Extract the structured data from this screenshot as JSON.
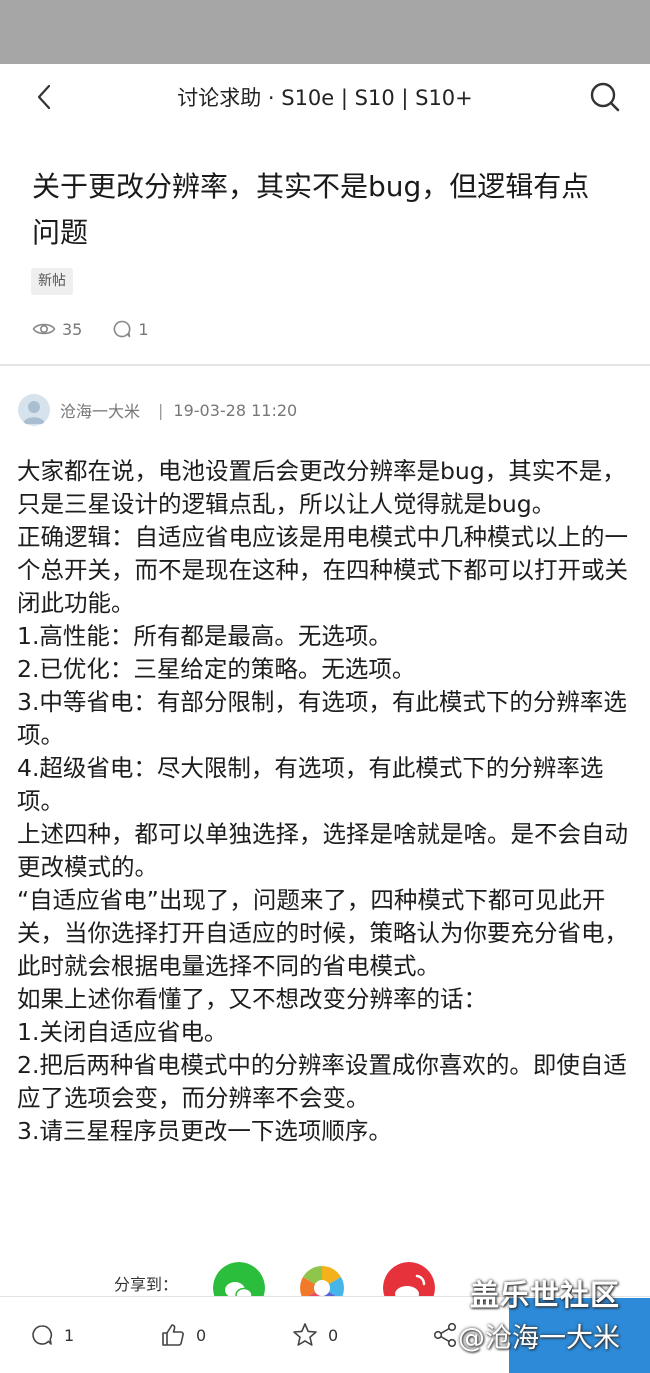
{
  "nav": {
    "title": "讨论求助 · S10e | S10 | S10+"
  },
  "post": {
    "title": "关于更改分辨率，其实不是bug，但逻辑有点问题",
    "tag": "新帖",
    "views": "35",
    "comments": "1",
    "author": "沧海一大米",
    "separator": "|",
    "timestamp": "19-03-28 11:20",
    "body": [
      "大家都在说，电池设置后会更改分辨率是bug，其实不是，只是三星设计的逻辑点乱，所以让人觉得就是bug。",
      "正确逻辑：自适应省电应该是用电模式中几种模式以上的一个总开关，而不是现在这种，在四种模式下都可以打开或关闭此功能。",
      "1.高性能：所有都是最高。无选项。",
      "2.已优化：三星给定的策略。无选项。",
      "3.中等省电：有部分限制，有选项，有此模式下的分辨率选项。",
      "4.超级省电：尽大限制，有选项，有此模式下的分辨率选项。",
      "上述四种，都可以单独选择，选择是啥就是啥。是不会自动更改模式的。",
      "“自适应省电”出现了，问题来了，四种模式下都可见此开关，当你选择打开自适应的时候，策略认为你要充分省电，此时就会根据电量选择不同的省电模式。",
      "如果上述你看懂了，又不想改变分辨率的话：",
      "1.关闭自适应省电。",
      "2.把后两种省电模式中的分辨率设置成你喜欢的。即使自适应了选项会变，而分辨率不会变。",
      "3.请三星程序员更改一下选项顺序。"
    ]
  },
  "share": {
    "label": "分享到："
  },
  "bottom_bar": {
    "comments": "1",
    "likes": "0",
    "favorites": "0"
  },
  "watermark": {
    "line1": "盖乐世社区",
    "line2": "@沧海一大米"
  },
  "colors": {
    "status_bar": "#a6a6a6",
    "wechat": "#2bbd3c",
    "weibo": "#e6323b",
    "watermark_box": "#2c8ad8"
  }
}
